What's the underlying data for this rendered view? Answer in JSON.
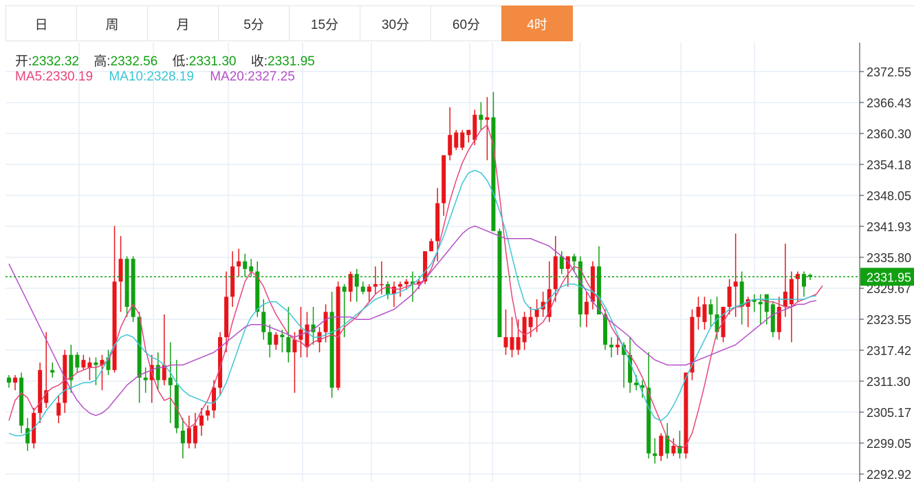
{
  "tabs": [
    {
      "label": "日",
      "active": false
    },
    {
      "label": "周",
      "active": false
    },
    {
      "label": "月",
      "active": false
    },
    {
      "label": "5分",
      "active": false
    },
    {
      "label": "15分",
      "active": false
    },
    {
      "label": "30分",
      "active": false
    },
    {
      "label": "60分",
      "active": false
    },
    {
      "label": "4时",
      "active": true
    }
  ],
  "ohlc": {
    "open_label": "开:",
    "open": "2332.32",
    "high_label": "高:",
    "high": "2332.56",
    "low_label": "低:",
    "low": "2331.30",
    "close_label": "收:",
    "close": "2331.95"
  },
  "ma": {
    "ma5_label": "MA5:",
    "ma5": "2330.19",
    "ma10_label": "MA10:",
    "ma10": "2328.19",
    "ma20_label": "MA20:",
    "ma20": "2327.25"
  },
  "colors": {
    "up": "#e8151b",
    "down": "#12a012",
    "ma5": "#e8457a",
    "ma10": "#3bc6d6",
    "ma20": "#b450c8",
    "active_tab": "#f28b41",
    "grid": "#e6eef5"
  },
  "chart_data": {
    "type": "candlestick",
    "y_ticks": [
      2372.55,
      2366.43,
      2360.3,
      2354.18,
      2348.05,
      2341.93,
      2335.8,
      2329.67,
      2323.55,
      2317.42,
      2311.3,
      2305.17,
      2299.05,
      2292.92
    ],
    "y_tick_labels": [
      "2372.55",
      "2366.43",
      "2360.30",
      "2354.18",
      "2348.05",
      "2341.93",
      "2335.80",
      "2329.67",
      "2323.55",
      "2317.42",
      "2311.30",
      "2305.17",
      "2299.05",
      "2292.92"
    ],
    "ylim": [
      2292.92,
      2372.55
    ],
    "current_price": "2331.95",
    "grid": true,
    "candles": [
      [
        2312.0,
        2312.5,
        2310.0,
        2311.0
      ],
      [
        2311.0,
        2312.5,
        2309.5,
        2312.0
      ],
      [
        2312.0,
        2313.0,
        2301.0,
        2302.5
      ],
      [
        2302.0,
        2304.0,
        2297.5,
        2299.0
      ],
      [
        2299.0,
        2306.0,
        2298.0,
        2305.0
      ],
      [
        2305.0,
        2315.0,
        2303.0,
        2313.5
      ],
      [
        2307.0,
        2321.0,
        2306.0,
        2309.5
      ],
      [
        2313.5,
        2315.0,
        2312.0,
        2313.0
      ],
      [
        2304.5,
        2308.5,
        2303.0,
        2307.0
      ],
      [
        2307.0,
        2317.5,
        2305.0,
        2316.5
      ],
      [
        2316.5,
        2318.5,
        2309.0,
        2311.5
      ],
      [
        2316.5,
        2317.0,
        2313.0,
        2314.0
      ],
      [
        2314.0,
        2316.5,
        2313.5,
        2315.5
      ],
      [
        2314.0,
        2316.0,
        2311.5,
        2315.0
      ],
      [
        2315.0,
        2316.0,
        2310.5,
        2314.5
      ],
      [
        2314.5,
        2316.5,
        2309.5,
        2315.5
      ],
      [
        2316.0,
        2317.5,
        2312.5,
        2313.5
      ],
      [
        2313.5,
        2342.0,
        2313.0,
        2331.0
      ],
      [
        2331.0,
        2340.0,
        2325.0,
        2335.5
      ],
      [
        2335.5,
        2336.0,
        2324.0,
        2326.0
      ],
      [
        2335.5,
        2336.0,
        2323.0,
        2324.0
      ],
      [
        2324.0,
        2325.0,
        2307.0,
        2312.0
      ],
      [
        2312.0,
        2314.0,
        2309.0,
        2311.5
      ],
      [
        2311.5,
        2316.5,
        2307.0,
        2314.5
      ],
      [
        2314.5,
        2317.0,
        2309.5,
        2311.5
      ],
      [
        2311.5,
        2324.5,
        2310.5,
        2314.5
      ],
      [
        2312.0,
        2319.0,
        2303.0,
        2310.5
      ],
      [
        2310.5,
        2315.5,
        2301.0,
        2302.0
      ],
      [
        2301.5,
        2304.0,
        2296.0,
        2299.0
      ],
      [
        2299.0,
        2304.5,
        2298.0,
        2302.0
      ],
      [
        2299.0,
        2305.0,
        2298.0,
        2302.5
      ],
      [
        2302.5,
        2306.0,
        2300.5,
        2304.5
      ],
      [
        2304.5,
        2306.5,
        2303.5,
        2305.5
      ],
      [
        2305.5,
        2311.5,
        2304.0,
        2310.0
      ],
      [
        2310.0,
        2321.0,
        2308.5,
        2320.0
      ],
      [
        2320.0,
        2333.0,
        2317.0,
        2328.0
      ],
      [
        2328.0,
        2337.0,
        2326.0,
        2334.0
      ],
      [
        2334.0,
        2337.5,
        2332.0,
        2335.0
      ],
      [
        2335.0,
        2336.5,
        2332.0,
        2333.5
      ],
      [
        2334.0,
        2335.5,
        2332.0,
        2333.0
      ],
      [
        2333.0,
        2335.0,
        2324.0,
        2325.0
      ],
      [
        2325.0,
        2327.5,
        2319.5,
        2321.0
      ],
      [
        2321.0,
        2322.5,
        2316.0,
        2318.5
      ],
      [
        2318.5,
        2321.0,
        2317.5,
        2320.5
      ],
      [
        2320.5,
        2321.5,
        2317.0,
        2320.0
      ],
      [
        2320.0,
        2326.0,
        2315.0,
        2317.0
      ],
      [
        2317.0,
        2321.0,
        2309.0,
        2319.5
      ],
      [
        2319.5,
        2326.0,
        2316.0,
        2321.5
      ],
      [
        2318.0,
        2325.0,
        2316.0,
        2322.5
      ],
      [
        2322.5,
        2326.0,
        2318.5,
        2321.0
      ],
      [
        2319.0,
        2322.0,
        2317.0,
        2321.0
      ],
      [
        2321.0,
        2326.5,
        2319.0,
        2325.0
      ],
      [
        2325.0,
        2329.0,
        2308.0,
        2310.0
      ],
      [
        2310.0,
        2331.0,
        2309.5,
        2330.0
      ],
      [
        2330.0,
        2330.5,
        2320.0,
        2329.0
      ],
      [
        2329.0,
        2333.0,
        2327.0,
        2332.5
      ],
      [
        2332.5,
        2333.5,
        2327.0,
        2330.0
      ],
      [
        2330.0,
        2331.0,
        2328.5,
        2329.0
      ],
      [
        2329.0,
        2330.5,
        2327.0,
        2330.0
      ],
      [
        2330.0,
        2334.0,
        2328.5,
        2330.5
      ],
      [
        2330.5,
        2335.0,
        2328.5,
        2330.5
      ],
      [
        2330.5,
        2331.0,
        2327.5,
        2328.5
      ],
      [
        2328.5,
        2331.0,
        2326.0,
        2330.0
      ],
      [
        2330.0,
        2331.0,
        2328.0,
        2330.5
      ],
      [
        2330.5,
        2331.5,
        2329.5,
        2331.0
      ],
      [
        2331.0,
        2333.0,
        2327.0,
        2330.5
      ],
      [
        2330.5,
        2331.5,
        2329.5,
        2331.0
      ],
      [
        2331.0,
        2335.0,
        2330.5,
        2337.0
      ],
      [
        2337.0,
        2339.5,
        2337.0,
        2339.0
      ],
      [
        2339.0,
        2349.5,
        2335.0,
        2346.5
      ],
      [
        2346.5,
        2356.0,
        2344.0,
        2356.0
      ],
      [
        2356.0,
        2365.5,
        2355.0,
        2360.0
      ],
      [
        2357.5,
        2361.0,
        2357.0,
        2360.5
      ],
      [
        2357.5,
        2361.0,
        2357.0,
        2360.5
      ],
      [
        2360.0,
        2361.0,
        2358.5,
        2361.0
      ],
      [
        2359.0,
        2365.0,
        2358.0,
        2364.0
      ],
      [
        2364.0,
        2366.5,
        2361.0,
        2363.0
      ],
      [
        2363.0,
        2367.5,
        2355.0,
        2363.5
      ],
      [
        2363.5,
        2368.5,
        2341.0,
        2341.0
      ],
      [
        2341.0,
        2341.5,
        2320.0,
        2320.0
      ],
      [
        2318.0,
        2325.5,
        2316.5,
        2320.0
      ],
      [
        2317.5,
        2324.0,
        2316.0,
        2320.0
      ],
      [
        2317.5,
        2323.5,
        2316.5,
        2320.0
      ],
      [
        2319.0,
        2325.0,
        2317.5,
        2324.0
      ],
      [
        2322.0,
        2326.0,
        2320.0,
        2324.0
      ],
      [
        2324.0,
        2327.5,
        2321.0,
        2325.5
      ],
      [
        2325.5,
        2329.0,
        2324.0,
        2327.0
      ],
      [
        2324.0,
        2335.0,
        2323.0,
        2329.5
      ],
      [
        2329.5,
        2340.0,
        2327.0,
        2336.0
      ],
      [
        2336.0,
        2337.0,
        2332.5,
        2333.5
      ],
      [
        2333.5,
        2336.0,
        2330.0,
        2336.0
      ],
      [
        2336.0,
        2336.5,
        2333.0,
        2335.0
      ],
      [
        2335.0,
        2336.0,
        2322.0,
        2324.5
      ],
      [
        2324.5,
        2329.0,
        2322.0,
        2327.0
      ],
      [
        2327.0,
        2335.0,
        2325.5,
        2334.0
      ],
      [
        2334.0,
        2338.0,
        2324.5,
        2324.5
      ],
      [
        2324.5,
        2325.5,
        2317.5,
        2318.5
      ],
      [
        2318.5,
        2320.0,
        2316.0,
        2318.0
      ],
      [
        2318.0,
        2320.0,
        2316.5,
        2318.5
      ],
      [
        2318.5,
        2319.0,
        2310.0,
        2316.5
      ],
      [
        2316.5,
        2320.0,
        2309.0,
        2311.0
      ],
      [
        2311.0,
        2312.5,
        2309.5,
        2310.5
      ],
      [
        2310.5,
        2311.5,
        2308.0,
        2310.0
      ],
      [
        2310.0,
        2317.0,
        2296.0,
        2297.0
      ],
      [
        2297.0,
        2300.0,
        2295.0,
        2296.5
      ],
      [
        2296.5,
        2301.0,
        2295.5,
        2300.5
      ],
      [
        2300.5,
        2303.0,
        2296.0,
        2297.0
      ],
      [
        2297.0,
        2300.0,
        2296.5,
        2298.5
      ],
      [
        2298.5,
        2301.5,
        2296.0,
        2297.0
      ],
      [
        2297.0,
        2312.5,
        2296.0,
        2313.0
      ],
      [
        2313.0,
        2325.5,
        2311.5,
        2324.0
      ],
      [
        2324.0,
        2328.0,
        2321.5,
        2326.0
      ],
      [
        2323.0,
        2328.0,
        2321.5,
        2326.5
      ],
      [
        2326.5,
        2327.5,
        2322.0,
        2324.5
      ],
      [
        2324.5,
        2328.0,
        2319.5,
        2321.0
      ],
      [
        2320.0,
        2326.0,
        2319.0,
        2326.0
      ],
      [
        2326.0,
        2331.5,
        2324.5,
        2330.0
      ],
      [
        2330.0,
        2340.5,
        2324.0,
        2331.0
      ],
      [
        2331.0,
        2333.0,
        2322.5,
        2326.0
      ],
      [
        2326.0,
        2328.0,
        2322.0,
        2327.5
      ],
      [
        2327.5,
        2328.5,
        2325.0,
        2327.0
      ],
      [
        2327.0,
        2328.5,
        2322.5,
        2326.5
      ],
      [
        2328.5,
        2327.0,
        2322.5,
        2325.0
      ],
      [
        2326.5,
        2327.0,
        2320.0,
        2321.0
      ],
      [
        2321.0,
        2328.0,
        2319.5,
        2326.0
      ],
      [
        2326.0,
        2338.5,
        2324.0,
        2329.0
      ],
      [
        2326.5,
        2333.0,
        2319.0,
        2331.5
      ],
      [
        2331.5,
        2333.0,
        2327.0,
        2332.5
      ],
      [
        2332.5,
        2333.0,
        2328.0,
        2330.0
      ],
      [
        2332.32,
        2332.56,
        2331.3,
        2331.95
      ]
    ],
    "series": [
      {
        "name": "MA5",
        "values": [
          2303.5,
          2307.5,
          2309.0,
          2308.0,
          2305.5,
          2307.0,
          2309.0,
          2310.0,
          2310.5,
          2311.5,
          2312.0,
          2313.0,
          2313.5,
          2314.0,
          2314.0,
          2314.5,
          2315.5,
          2318.0,
          2322.0,
          2324.5,
          2326.5,
          2324.5,
          2317.5,
          2313.0,
          2309.5,
          2307.5,
          2308.0,
          2306.0,
          2303.5,
          2302.0,
          2303.0,
          2305.5,
          2307.5,
          2310.5,
          2314.0,
          2318.0,
          2323.0,
          2327.0,
          2331.0,
          2333.0,
          2332.0,
          2330.0,
          2327.0,
          2324.5,
          2322.5,
          2320.5,
          2319.5,
          2319.0,
          2318.0,
          2319.0,
          2319.5,
          2320.0,
          2320.5,
          2320.0,
          2322.0,
          2323.0,
          2324.0,
          2325.5,
          2327.0,
          2328.5,
          2329.5,
          2330.0,
          2329.5,
          2329.5,
          2330.0,
          2330.5,
          2330.5,
          2331.5,
          2333.5,
          2337.0,
          2342.0,
          2347.0,
          2351.0,
          2354.5,
          2357.0,
          2359.0,
          2361.0,
          2362.0,
          2358.0,
          2348.0,
          2337.0,
          2328.0,
          2321.5,
          2320.5,
          2321.0,
          2322.0,
          2323.0,
          2325.0,
          2328.0,
          2330.5,
          2332.5,
          2334.0,
          2333.5,
          2331.0,
          2329.0,
          2327.5,
          2325.0,
          2322.0,
          2320.0,
          2318.0,
          2316.5,
          2314.5,
          2312.0,
          2309.0,
          2306.0,
          2303.0,
          2300.0,
          2299.0,
          2298.0,
          2298.5,
          2301.0,
          2305.5,
          2310.5,
          2316.0,
          2321.0,
          2323.0,
          2325.0,
          2326.0,
          2326.0,
          2327.0,
          2327.5,
          2327.5,
          2327.0,
          2327.0,
          2326.5,
          2326.0,
          2326.0,
          2327.0,
          2327.5,
          2328.0,
          2328.5,
          2330.19
        ]
      },
      {
        "name": "MA10",
        "values": [
          2301.0,
          2300.5,
          2300.5,
          2301.0,
          2302.0,
          2303.5,
          2305.5,
          2307.0,
          2308.5,
          2309.5,
          2310.0,
          2310.5,
          2311.0,
          2311.0,
          2311.5,
          2313.5,
          2316.0,
          2318.5,
          2320.0,
          2320.5,
          2320.0,
          2318.5,
          2317.0,
          2316.0,
          2315.5,
          2314.5,
          2313.0,
          2311.0,
          2309.5,
          2308.5,
          2308.0,
          2307.5,
          2307.0,
          2307.0,
          2308.5,
          2311.0,
          2314.5,
          2318.0,
          2321.5,
          2324.0,
          2325.5,
          2326.5,
          2327.0,
          2327.0,
          2326.0,
          2325.0,
          2323.5,
          2322.0,
          2321.0,
          2320.0,
          2320.0,
          2320.5,
          2321.0,
          2321.5,
          2322.5,
          2323.5,
          2324.5,
          2325.5,
          2326.5,
          2327.5,
          2328.0,
          2328.5,
          2328.5,
          2329.0,
          2329.5,
          2330.5,
          2331.5,
          2333.0,
          2334.5,
          2337.0,
          2340.0,
          2343.5,
          2347.0,
          2350.5,
          2352.5,
          2353.0,
          2352.5,
          2351.0,
          2348.5,
          2345.0,
          2341.0,
          2336.0,
          2331.0,
          2327.0,
          2325.5,
          2325.5,
          2326.0,
          2327.5,
          2329.0,
          2330.0,
          2330.5,
          2330.5,
          2330.0,
          2329.5,
          2329.0,
          2328.0,
          2326.0,
          2323.5,
          2320.5,
          2318.0,
          2315.0,
          2312.0,
          2309.0,
          2306.0,
          2304.0,
          2303.5,
          2304.5,
          2306.5,
          2309.0,
          2312.0,
          2314.5,
          2317.0,
          2319.5,
          2322.0,
          2323.5,
          2324.5,
          2325.5,
          2326.0,
          2326.5,
          2327.0,
          2327.5,
          2327.5,
          2327.5,
          2327.5,
          2327.5,
          2327.5,
          2327.5,
          2327.5,
          2327.5,
          2328.0,
          2328.19
        ]
      },
      {
        "name": "MA20",
        "values": [
          2334.5,
          2332.0,
          2329.5,
          2327.0,
          2324.5,
          2322.0,
          2319.5,
          2317.0,
          2314.5,
          2312.0,
          2309.5,
          2307.5,
          2306.0,
          2305.0,
          2304.5,
          2305.0,
          2306.0,
          2307.5,
          2309.0,
          2310.5,
          2311.5,
          2312.5,
          2313.0,
          2313.5,
          2314.0,
          2314.0,
          2314.5,
          2314.5,
          2314.5,
          2315.0,
          2315.5,
          2316.0,
          2316.5,
          2317.0,
          2318.0,
          2319.0,
          2320.0,
          2321.0,
          2322.0,
          2322.5,
          2322.5,
          2322.5,
          2322.0,
          2321.5,
          2321.0,
          2320.5,
          2320.0,
          2320.5,
          2321.0,
          2321.5,
          2322.5,
          2323.5,
          2324.0,
          2324.0,
          2324.0,
          2324.0,
          2323.5,
          2323.5,
          2323.5,
          2324.0,
          2324.5,
          2325.0,
          2325.5,
          2326.5,
          2327.5,
          2328.5,
          2330.0,
          2331.5,
          2333.0,
          2334.5,
          2336.0,
          2337.5,
          2339.0,
          2340.5,
          2341.5,
          2342.0,
          2341.5,
          2341.0,
          2340.5,
          2340.0,
          2339.5,
          2339.5,
          2339.5,
          2339.5,
          2339.5,
          2339.0,
          2338.5,
          2338.0,
          2337.0,
          2336.0,
          2335.0,
          2333.0,
          2331.0,
          2329.0,
          2327.0,
          2325.5,
          2324.0,
          2323.0,
          2322.0,
          2321.0,
          2320.0,
          2318.5,
          2317.5,
          2316.5,
          2315.5,
          2315.0,
          2314.5,
          2314.5,
          2314.5,
          2314.5,
          2315.0,
          2315.5,
          2316.0,
          2316.5,
          2317.0,
          2317.5,
          2318.0,
          2318.5,
          2319.5,
          2320.5,
          2321.5,
          2322.5,
          2323.5,
          2324.5,
          2325.0,
          2325.5,
          2326.0,
          2326.5,
          2326.5,
          2327.0,
          2327.25
        ]
      }
    ]
  }
}
